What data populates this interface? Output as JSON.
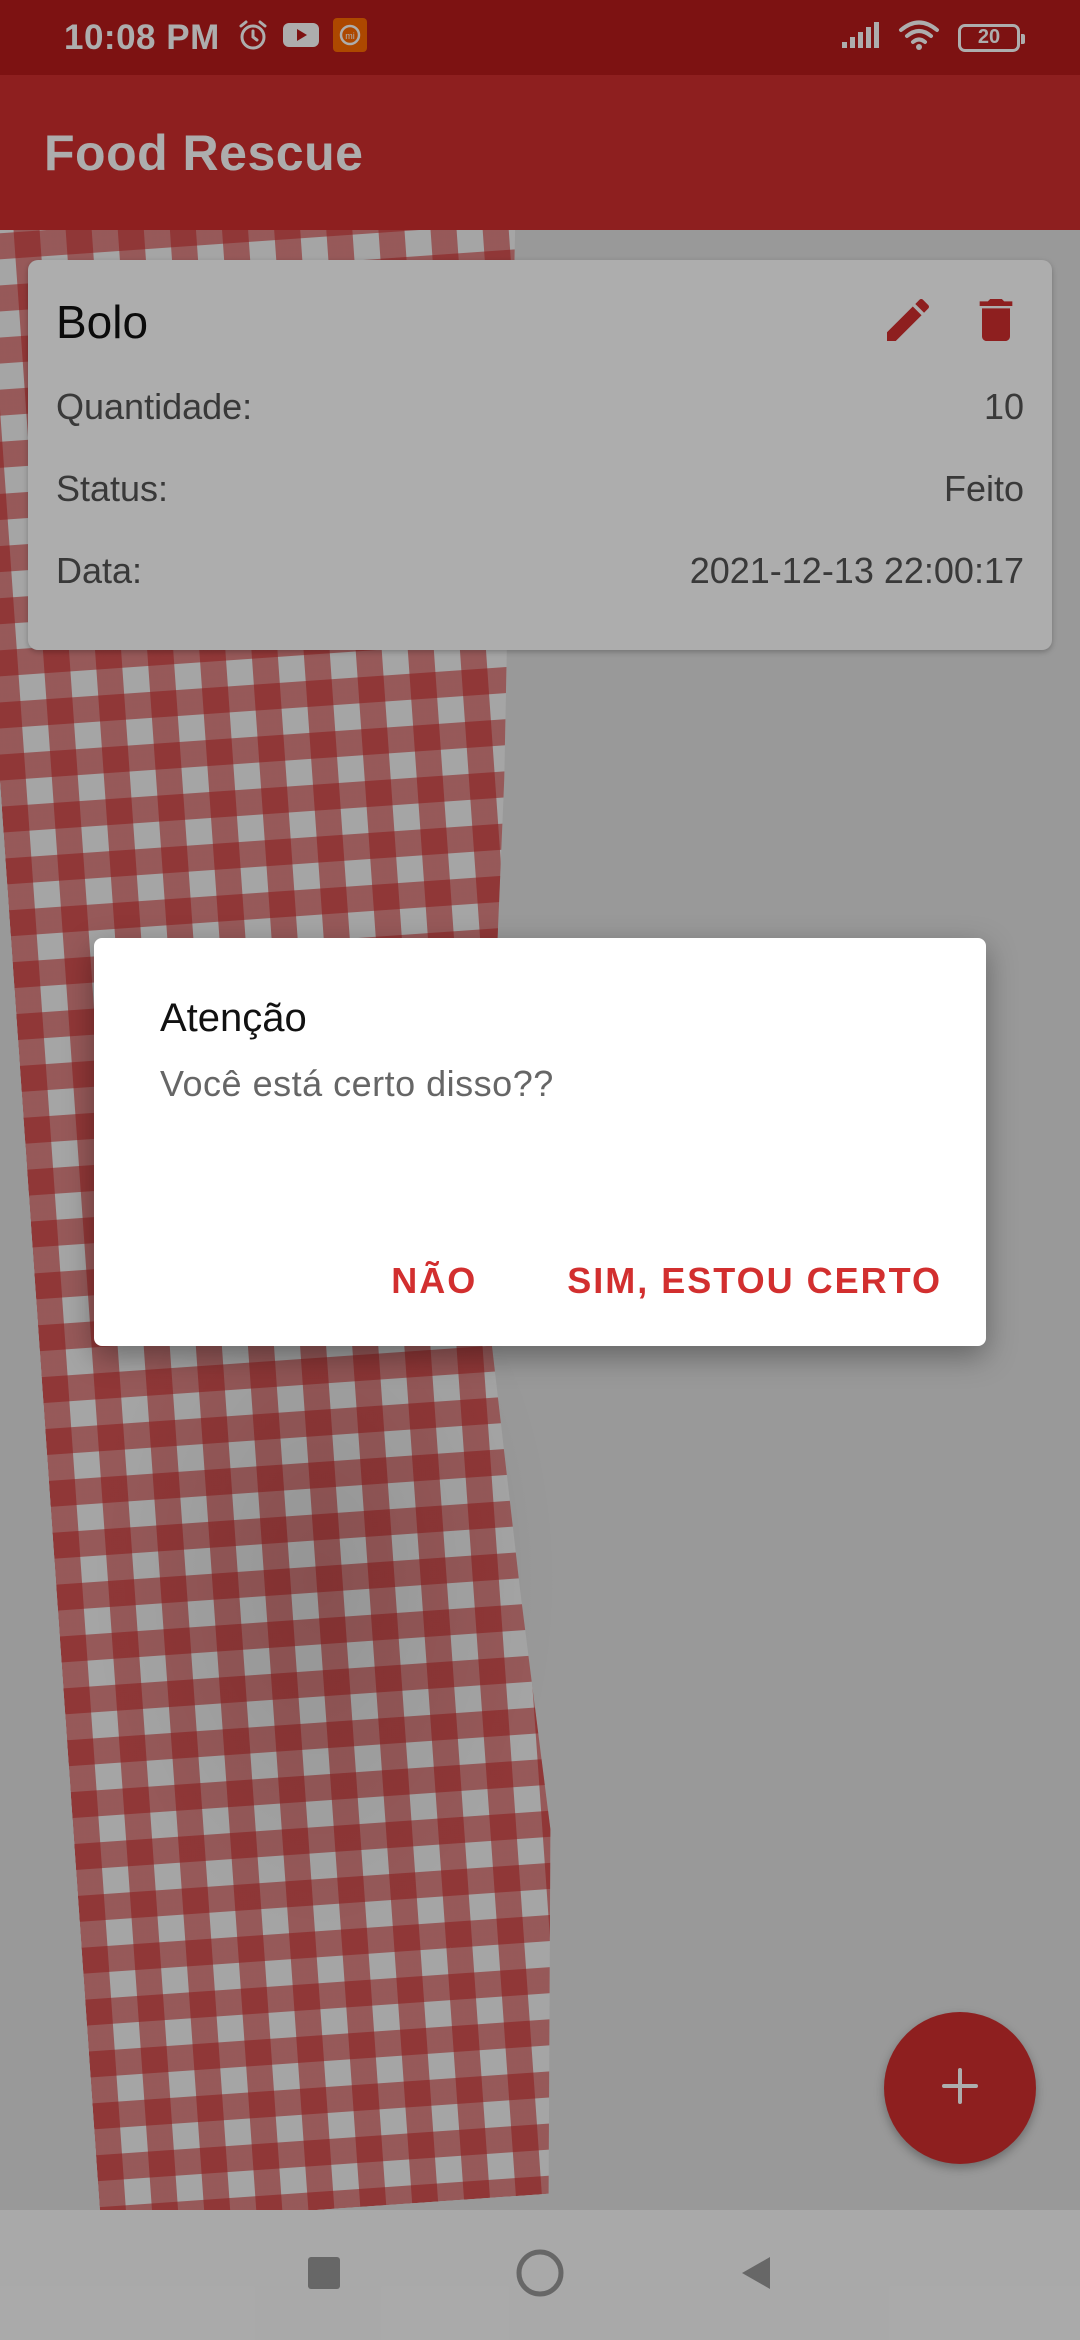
{
  "status_bar": {
    "time": "10:08 PM",
    "battery": "20",
    "icons": [
      "alarm-icon",
      "youtube-icon",
      "mi-app-icon",
      "signal-icon",
      "wifi-icon",
      "battery-icon"
    ]
  },
  "app_bar": {
    "title": "Food Rescue"
  },
  "card": {
    "title": "Bolo",
    "rows": [
      {
        "label": "Quantidade:",
        "value": "10"
      },
      {
        "label": "Status:",
        "value": "Feito"
      },
      {
        "label": "Data:",
        "value": "2021-12-13 22:00:17"
      }
    ],
    "icons": [
      "edit-icon",
      "delete-icon"
    ]
  },
  "fab": {
    "icon": "add-icon"
  },
  "dialog": {
    "title": "Atenção",
    "message": "Você está certo disso??",
    "negative_label": "NÃO",
    "positive_label": "SIM, ESTOU CERTO"
  },
  "colors": {
    "primary": "#d22f2f",
    "status_bar": "#b81b1b"
  }
}
